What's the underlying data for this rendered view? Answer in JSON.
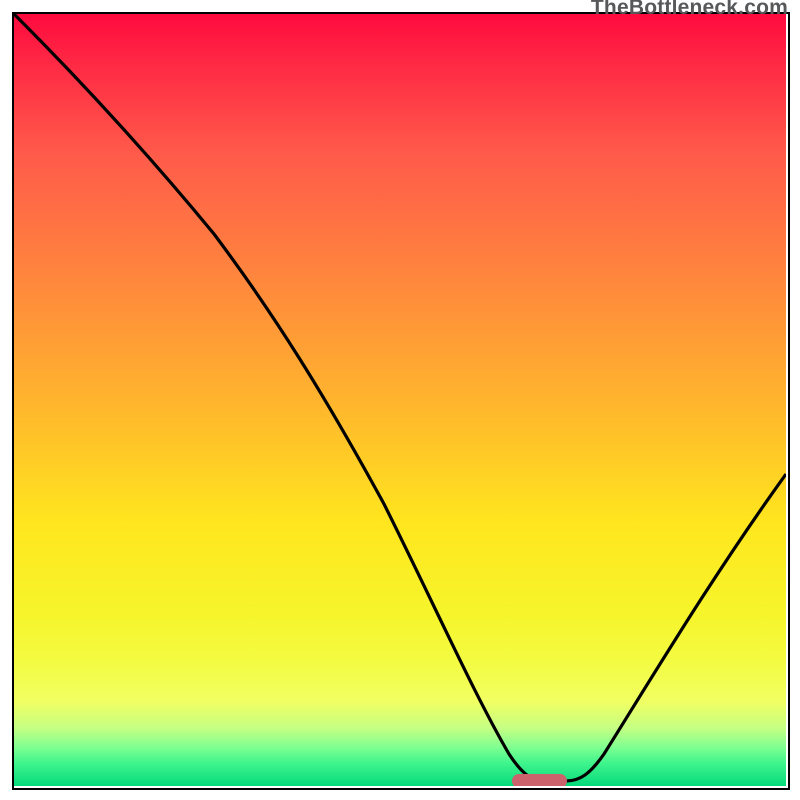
{
  "watermark": "TheBottleneck.com",
  "chart_data": {
    "type": "line",
    "title": "",
    "xlabel": "",
    "ylabel": "",
    "xlim": [
      0,
      100
    ],
    "ylim": [
      0,
      100
    ],
    "x": [
      0,
      5,
      10,
      15,
      20,
      25,
      30,
      35,
      40,
      45,
      50,
      55,
      60,
      62.5,
      65,
      67.5,
      70,
      75,
      80,
      85,
      90,
      95,
      100
    ],
    "values": [
      100,
      95,
      89,
      83,
      77,
      71,
      64,
      56,
      48,
      39,
      30,
      20,
      10,
      5,
      2,
      0,
      0,
      7,
      15,
      23,
      30,
      37,
      43
    ],
    "minimum_region": {
      "x_start": 63,
      "x_end": 71,
      "y": 0
    },
    "gradient": {
      "top_color": "#ff0a3e",
      "bottom_color": "#05da7b"
    }
  }
}
